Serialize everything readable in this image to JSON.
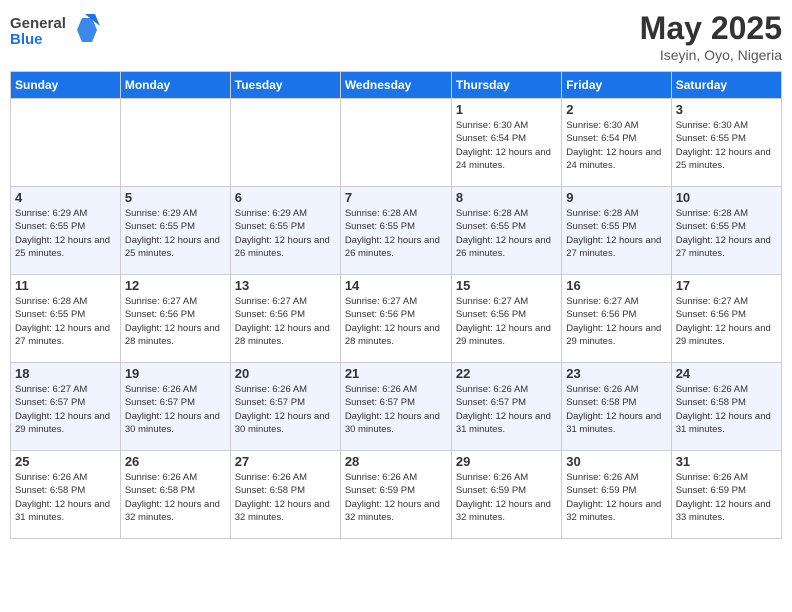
{
  "logo": {
    "general": "General",
    "blue": "Blue"
  },
  "title": "May 2025",
  "subtitle": "Iseyin, Oyo, Nigeria",
  "days_of_week": [
    "Sunday",
    "Monday",
    "Tuesday",
    "Wednesday",
    "Thursday",
    "Friday",
    "Saturday"
  ],
  "weeks": [
    [
      {
        "day": "",
        "info": ""
      },
      {
        "day": "",
        "info": ""
      },
      {
        "day": "",
        "info": ""
      },
      {
        "day": "",
        "info": ""
      },
      {
        "day": "1",
        "info": "Sunrise: 6:30 AM\nSunset: 6:54 PM\nDaylight: 12 hours and 24 minutes."
      },
      {
        "day": "2",
        "info": "Sunrise: 6:30 AM\nSunset: 6:54 PM\nDaylight: 12 hours and 24 minutes."
      },
      {
        "day": "3",
        "info": "Sunrise: 6:30 AM\nSunset: 6:55 PM\nDaylight: 12 hours and 25 minutes."
      }
    ],
    [
      {
        "day": "4",
        "info": "Sunrise: 6:29 AM\nSunset: 6:55 PM\nDaylight: 12 hours and 25 minutes."
      },
      {
        "day": "5",
        "info": "Sunrise: 6:29 AM\nSunset: 6:55 PM\nDaylight: 12 hours and 25 minutes."
      },
      {
        "day": "6",
        "info": "Sunrise: 6:29 AM\nSunset: 6:55 PM\nDaylight: 12 hours and 26 minutes."
      },
      {
        "day": "7",
        "info": "Sunrise: 6:28 AM\nSunset: 6:55 PM\nDaylight: 12 hours and 26 minutes."
      },
      {
        "day": "8",
        "info": "Sunrise: 6:28 AM\nSunset: 6:55 PM\nDaylight: 12 hours and 26 minutes."
      },
      {
        "day": "9",
        "info": "Sunrise: 6:28 AM\nSunset: 6:55 PM\nDaylight: 12 hours and 27 minutes."
      },
      {
        "day": "10",
        "info": "Sunrise: 6:28 AM\nSunset: 6:55 PM\nDaylight: 12 hours and 27 minutes."
      }
    ],
    [
      {
        "day": "11",
        "info": "Sunrise: 6:28 AM\nSunset: 6:55 PM\nDaylight: 12 hours and 27 minutes."
      },
      {
        "day": "12",
        "info": "Sunrise: 6:27 AM\nSunset: 6:56 PM\nDaylight: 12 hours and 28 minutes."
      },
      {
        "day": "13",
        "info": "Sunrise: 6:27 AM\nSunset: 6:56 PM\nDaylight: 12 hours and 28 minutes."
      },
      {
        "day": "14",
        "info": "Sunrise: 6:27 AM\nSunset: 6:56 PM\nDaylight: 12 hours and 28 minutes."
      },
      {
        "day": "15",
        "info": "Sunrise: 6:27 AM\nSunset: 6:56 PM\nDaylight: 12 hours and 29 minutes."
      },
      {
        "day": "16",
        "info": "Sunrise: 6:27 AM\nSunset: 6:56 PM\nDaylight: 12 hours and 29 minutes."
      },
      {
        "day": "17",
        "info": "Sunrise: 6:27 AM\nSunset: 6:56 PM\nDaylight: 12 hours and 29 minutes."
      }
    ],
    [
      {
        "day": "18",
        "info": "Sunrise: 6:27 AM\nSunset: 6:57 PM\nDaylight: 12 hours and 29 minutes."
      },
      {
        "day": "19",
        "info": "Sunrise: 6:26 AM\nSunset: 6:57 PM\nDaylight: 12 hours and 30 minutes."
      },
      {
        "day": "20",
        "info": "Sunrise: 6:26 AM\nSunset: 6:57 PM\nDaylight: 12 hours and 30 minutes."
      },
      {
        "day": "21",
        "info": "Sunrise: 6:26 AM\nSunset: 6:57 PM\nDaylight: 12 hours and 30 minutes."
      },
      {
        "day": "22",
        "info": "Sunrise: 6:26 AM\nSunset: 6:57 PM\nDaylight: 12 hours and 31 minutes."
      },
      {
        "day": "23",
        "info": "Sunrise: 6:26 AM\nSunset: 6:58 PM\nDaylight: 12 hours and 31 minutes."
      },
      {
        "day": "24",
        "info": "Sunrise: 6:26 AM\nSunset: 6:58 PM\nDaylight: 12 hours and 31 minutes."
      }
    ],
    [
      {
        "day": "25",
        "info": "Sunrise: 6:26 AM\nSunset: 6:58 PM\nDaylight: 12 hours and 31 minutes."
      },
      {
        "day": "26",
        "info": "Sunrise: 6:26 AM\nSunset: 6:58 PM\nDaylight: 12 hours and 32 minutes."
      },
      {
        "day": "27",
        "info": "Sunrise: 6:26 AM\nSunset: 6:58 PM\nDaylight: 12 hours and 32 minutes."
      },
      {
        "day": "28",
        "info": "Sunrise: 6:26 AM\nSunset: 6:59 PM\nDaylight: 12 hours and 32 minutes."
      },
      {
        "day": "29",
        "info": "Sunrise: 6:26 AM\nSunset: 6:59 PM\nDaylight: 12 hours and 32 minutes."
      },
      {
        "day": "30",
        "info": "Sunrise: 6:26 AM\nSunset: 6:59 PM\nDaylight: 12 hours and 32 minutes."
      },
      {
        "day": "31",
        "info": "Sunrise: 6:26 AM\nSunset: 6:59 PM\nDaylight: 12 hours and 33 minutes."
      }
    ]
  ]
}
